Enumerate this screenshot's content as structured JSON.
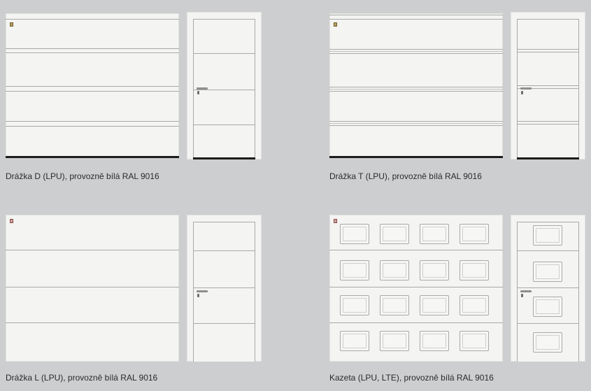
{
  "variants": [
    {
      "id": "drazka-d",
      "caption": "Drážka D (LPU), provozně bílá RAL 9016"
    },
    {
      "id": "drazka-t",
      "caption": "Drážka T (LPU), provozně bílá RAL 9016"
    },
    {
      "id": "drazka-l",
      "caption": "Drážka L (LPU), provozně bílá RAL 9016"
    },
    {
      "id": "kazeta",
      "caption": "Kazeta (LPU, LTE), provozně bílá RAL 9016"
    }
  ],
  "colors": {
    "background": "#cdcecf",
    "door_white": "#f4f4f2",
    "groove": "#a9a9a7",
    "seal": "#1c1c1c"
  }
}
